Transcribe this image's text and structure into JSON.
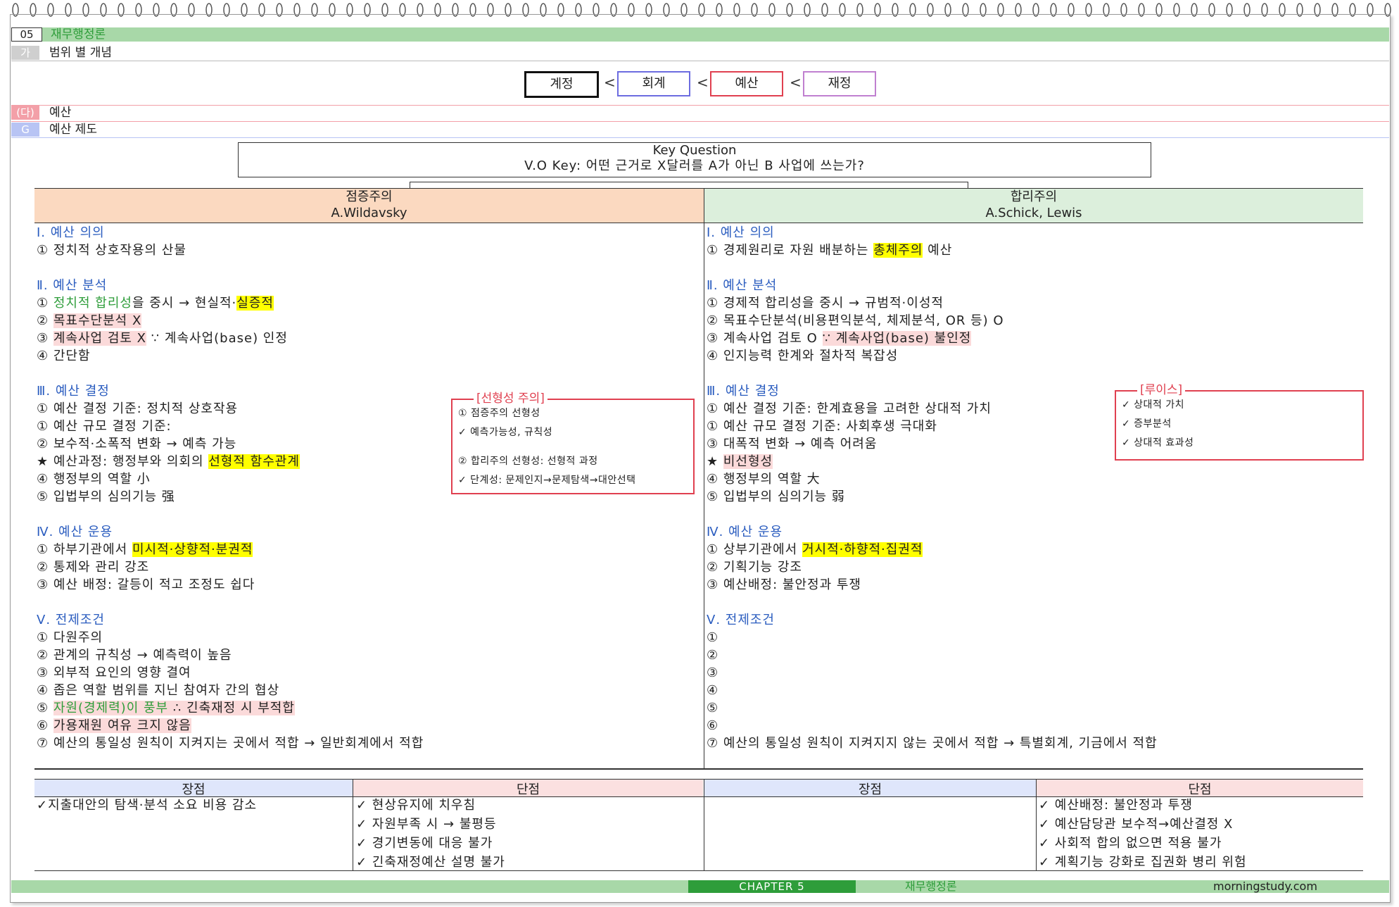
{
  "header": {
    "chapter_num": "05",
    "chapter_title": "재무행정론",
    "sub_tag": "가",
    "sub_title": "범위 별 개념",
    "sec_tag": "(다)",
    "sec_title": "예산",
    "g_tag": "G",
    "g_title": "예산 제도"
  },
  "hierarchy": {
    "boxes": [
      "계정",
      "회계",
      "예산",
      "재정"
    ],
    "separator": "<"
  },
  "key_question": {
    "title": "Key Question",
    "text": "V.O Key: 어떤 근거로 X달러를 A가 아닌 B 사업에 쓰는가?"
  },
  "left": {
    "header_title": "점증주의",
    "header_author": "A.Wildavsky",
    "lines": [
      {
        "parts": [
          {
            "t": "Ⅰ. 예산 의의",
            "c": "sec"
          }
        ]
      },
      {
        "parts": [
          {
            "t": "① 정치적 상호작용의 산물"
          }
        ]
      },
      {
        "parts": []
      },
      {
        "parts": [
          {
            "t": "Ⅱ. 예산 분석",
            "c": "sec"
          }
        ]
      },
      {
        "parts": [
          {
            "t": "① "
          },
          {
            "t": "정치적 합리성",
            "c": "grn"
          },
          {
            "t": "을 중시 → 현실적·"
          },
          {
            "t": "실증적",
            "c": "hl-y"
          }
        ]
      },
      {
        "parts": [
          {
            "t": "② "
          },
          {
            "t": "목표수단분석 X",
            "c": "hl-p"
          }
        ]
      },
      {
        "parts": [
          {
            "t": "③ "
          },
          {
            "t": "계속사업 검토 X",
            "c": "hl-p"
          },
          {
            "t": " ∵ 계속사업(base) 인정"
          }
        ]
      },
      {
        "parts": [
          {
            "t": "④ 간단함"
          }
        ]
      },
      {
        "parts": []
      },
      {
        "parts": [
          {
            "t": "Ⅲ. 예산 결정",
            "c": "sec"
          }
        ]
      },
      {
        "parts": [
          {
            "t": "① 예산 결정 기준: 정치적 상호작용"
          }
        ]
      },
      {
        "parts": [
          {
            "t": "① 예산 규모 결정 기준:"
          }
        ]
      },
      {
        "parts": [
          {
            "t": "② 보수적·소폭적 변화 → 예측 가능"
          }
        ]
      },
      {
        "parts": [
          {
            "t": "★ 예산과정: 행정부와 의회의 "
          },
          {
            "t": "선형적 함수관계",
            "c": "hl-y"
          }
        ]
      },
      {
        "parts": [
          {
            "t": "④ 행정부의 역할 小"
          }
        ]
      },
      {
        "parts": [
          {
            "t": "⑤ 입법부의 심의기능 强"
          }
        ]
      },
      {
        "parts": []
      },
      {
        "parts": [
          {
            "t": "Ⅳ. 예산 운용",
            "c": "sec"
          }
        ]
      },
      {
        "parts": [
          {
            "t": "① 하부기관에서 "
          },
          {
            "t": "미시적·상향적·분권적",
            "c": "hl-y"
          }
        ]
      },
      {
        "parts": [
          {
            "t": "② 통제와 관리 강조"
          }
        ]
      },
      {
        "parts": [
          {
            "t": "③ 예산 배정: 갈등이 적고 조정도 쉽다"
          }
        ]
      },
      {
        "parts": []
      },
      {
        "parts": [
          {
            "t": "Ⅴ. 전제조건",
            "c": "sec"
          }
        ]
      },
      {
        "parts": [
          {
            "t": "① 다원주의"
          }
        ]
      },
      {
        "parts": [
          {
            "t": "② 관계의 규칙성 → 예측력이 높음"
          }
        ]
      },
      {
        "parts": [
          {
            "t": "③ 외부적 요인의 영향 결여"
          }
        ]
      },
      {
        "parts": [
          {
            "t": "④ 좁은 역할 범위를 지닌 참여자 간의 협상"
          }
        ]
      },
      {
        "parts": [
          {
            "t": "⑤ "
          },
          {
            "t": "자원(경제력)이 풍부",
            "c": "grn hl-p"
          },
          {
            "t": " ∴ 긴축재정 시 부적합",
            "c": "hl-p"
          }
        ]
      },
      {
        "parts": [
          {
            "t": "⑥ "
          },
          {
            "t": "가용재원 여유 크지 않음",
            "c": "hl-p"
          }
        ]
      },
      {
        "parts": [
          {
            "t": "⑦ 예산의 통일성 원칙이 지켜지는 곳에서 적합 → 일반회계에서 적합"
          }
        ]
      }
    ]
  },
  "right": {
    "header_title": "합리주의",
    "header_author": "A.Schick, Lewis",
    "lines": [
      {
        "parts": [
          {
            "t": "Ⅰ. 예산 의의",
            "c": "sec"
          }
        ]
      },
      {
        "parts": [
          {
            "t": "① 경제원리로 자원 배분하는 "
          },
          {
            "t": "총체주의",
            "c": "hl-y"
          },
          {
            "t": " 예산"
          }
        ]
      },
      {
        "parts": []
      },
      {
        "parts": [
          {
            "t": "Ⅱ. 예산 분석",
            "c": "sec"
          }
        ]
      },
      {
        "parts": [
          {
            "t": "① 경제적 합리성을 중시 → 규범적·이성적"
          }
        ]
      },
      {
        "parts": [
          {
            "t": "② 목표수단분석(비용편익분석, 체제분석, OR 등) O"
          }
        ]
      },
      {
        "parts": [
          {
            "t": "③ 계속사업 검토 O "
          },
          {
            "t": "∵ 계속사업(base) 불인정",
            "c": "hl-p"
          }
        ]
      },
      {
        "parts": [
          {
            "t": "④ 인지능력 한계와 절차적 복잡성"
          }
        ]
      },
      {
        "parts": []
      },
      {
        "parts": [
          {
            "t": "Ⅲ. 예산 결정",
            "c": "sec"
          }
        ]
      },
      {
        "parts": [
          {
            "t": "① 예산 결정 기준: 한계효용을 고려한 상대적 가치"
          }
        ]
      },
      {
        "parts": [
          {
            "t": "① 예산 규모 결정 기준: 사회후생 극대화"
          }
        ]
      },
      {
        "parts": [
          {
            "t": "③ 대폭적 변화 → 예측 어려움"
          }
        ]
      },
      {
        "parts": [
          {
            "t": "★ "
          },
          {
            "t": "비선형성",
            "c": "hl-p"
          }
        ]
      },
      {
        "parts": [
          {
            "t": "④ 행정부의 역할 大"
          }
        ]
      },
      {
        "parts": [
          {
            "t": "⑤ 입법부의 심의기능 弱"
          }
        ]
      },
      {
        "parts": []
      },
      {
        "parts": [
          {
            "t": "Ⅳ. 예산 운용",
            "c": "sec"
          }
        ]
      },
      {
        "parts": [
          {
            "t": "① 상부기관에서 "
          },
          {
            "t": "거시적·하향적·집권적",
            "c": "hl-y"
          }
        ]
      },
      {
        "parts": [
          {
            "t": "② 기획기능 강조"
          }
        ]
      },
      {
        "parts": [
          {
            "t": "③ 예산배정: 불안정과 투쟁"
          }
        ]
      },
      {
        "parts": []
      },
      {
        "parts": [
          {
            "t": "Ⅴ. 전제조건",
            "c": "sec"
          }
        ]
      },
      {
        "parts": [
          {
            "t": "①"
          }
        ]
      },
      {
        "parts": [
          {
            "t": "②"
          }
        ]
      },
      {
        "parts": [
          {
            "t": "③"
          }
        ]
      },
      {
        "parts": [
          {
            "t": "④"
          }
        ]
      },
      {
        "parts": [
          {
            "t": "⑤"
          }
        ]
      },
      {
        "parts": [
          {
            "t": "⑥"
          }
        ]
      },
      {
        "parts": [
          {
            "t": "⑦ 예산의 통일성 원칙이 지켜지지 않는 곳에서 적합 → 특별회계, 기금에서 적합"
          }
        ]
      }
    ]
  },
  "note_left": {
    "title": "[선형성 주의]",
    "lines": [
      "① 점증주의 선형성",
      "✓ 예측가능성, 규칙성",
      "",
      "② 합리주의 선형성: 선형적 과정",
      "✓ 단계성: 문제인지→문제탐색→대안선택"
    ]
  },
  "note_right": {
    "title": "[루이스]",
    "lines": [
      "✓ 상대적 가치",
      "✓ 증부분석",
      "✓ 상대적 효과성"
    ]
  },
  "proscons": {
    "h1": "장점",
    "h2": "단점",
    "h3": "장점",
    "h4": "단점",
    "c1": [
      "✓지출대안의 탐색·분석 소요 비용 감소"
    ],
    "c2": [
      "✓ 현상유지에 치우침",
      "✓ 자원부족 시 → 불평등",
      "✓ 경기변동에 대응 불가",
      "✓ 긴축재정예산 설명 불가"
    ],
    "c3": [],
    "c4": [
      "✓ 예산배정: 불안정과 투쟁",
      "✓ 예산담당관 보수적→예산결정 X",
      "✓ 사회적 합의 없으면 적용 불가",
      "✓ 계획기능 강화로 집권화 병리 위험"
    ]
  },
  "footer": {
    "chapter": "CHAPTER 5",
    "title": "재무행정론",
    "site": "morningstudy.com"
  },
  "colors": {
    "green_bar": "#a8d8a8",
    "chapter_green": "#2e9d3a",
    "left_header_bg": "#fbd9c0",
    "right_header_bg": "#dcefdc",
    "pros_bg": "#dfe6fb",
    "cons_bg": "#fbe0e0",
    "section_blue": "#2a5cbf",
    "note_red": "#e04050"
  }
}
